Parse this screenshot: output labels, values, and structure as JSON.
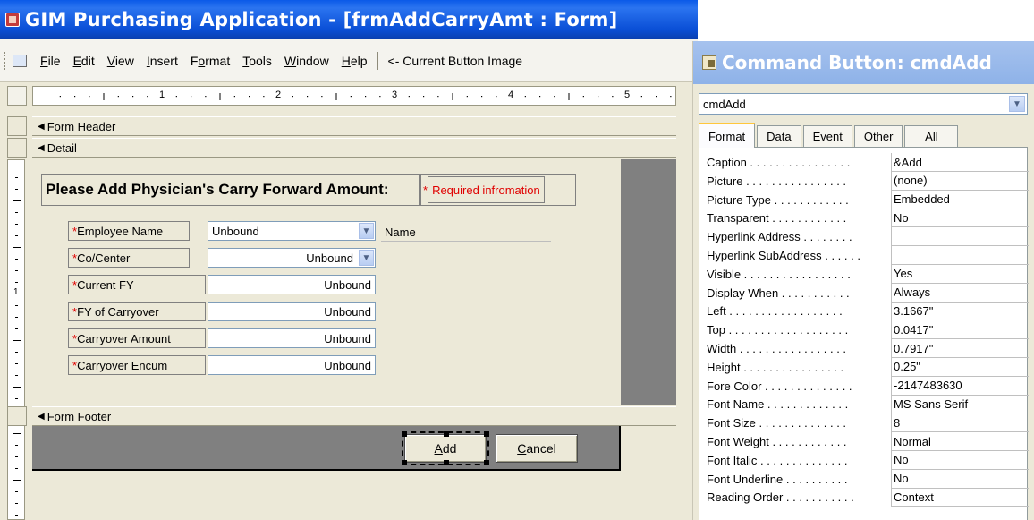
{
  "main_window": {
    "title": "GIM Purchasing Application - [frmAddCarryAmt : Form]"
  },
  "menu": {
    "items": [
      {
        "pre": "",
        "ul": "F",
        "post": "ile"
      },
      {
        "pre": "",
        "ul": "E",
        "post": "dit"
      },
      {
        "pre": "",
        "ul": "V",
        "post": "iew"
      },
      {
        "pre": "",
        "ul": "I",
        "post": "nsert"
      },
      {
        "pre": "F",
        "ul": "o",
        "post": "rmat"
      },
      {
        "pre": "",
        "ul": "T",
        "post": "ools"
      },
      {
        "pre": "",
        "ul": "W",
        "post": "indow"
      },
      {
        "pre": "",
        "ul": "H",
        "post": "elp"
      }
    ],
    "current_button_image": "<- Current Button Image"
  },
  "ruler": {
    "numbers": [
      "1",
      "2",
      "3",
      "4",
      "5"
    ],
    "vertical_numbers": [
      "1"
    ]
  },
  "sections": {
    "form_header": "Form Header",
    "detail": "Detail",
    "form_footer": "Form Footer"
  },
  "form": {
    "heading": "Please Add Physician's Carry Forward Amount:",
    "required_asterisk": "*",
    "required_text": "Required infromation",
    "fields": [
      {
        "label": "Employee Name",
        "value": "Unbound",
        "type": "combo-left"
      },
      {
        "label": "Co/Center",
        "value": "Unbound",
        "type": "combo-right"
      },
      {
        "label": "Current FY",
        "value": "Unbound",
        "type": "text"
      },
      {
        "label": "FY of Carryover",
        "value": "Unbound",
        "type": "text"
      },
      {
        "label": "Carryover Amount",
        "value": "Unbound",
        "type": "text"
      },
      {
        "label": "Carryover Encum",
        "value": "Unbound",
        "type": "text"
      }
    ],
    "name_label": "Name"
  },
  "footer": {
    "add": {
      "ul": "A",
      "post": "dd"
    },
    "cancel": {
      "ul": "C",
      "post": "ancel"
    }
  },
  "property_sheet": {
    "title": "Command Button: cmdAdd",
    "selected_object": "cmdAdd",
    "tabs": [
      "Format",
      "Data",
      "Event",
      "Other",
      "All"
    ],
    "active_tab": "Format",
    "properties": [
      {
        "name": "Caption . . . . . . . . . . . . . . . .",
        "value": "&Add"
      },
      {
        "name": "Picture . . . . . . . . . . . . . . . .",
        "value": "(none)"
      },
      {
        "name": "Picture Type . . . . . . . . . . . .",
        "value": "Embedded"
      },
      {
        "name": "Transparent . . . . . . . . . . . .",
        "value": "No"
      },
      {
        "name": "Hyperlink Address . . . . . . . .",
        "value": ""
      },
      {
        "name": "Hyperlink SubAddress . . . . . .",
        "value": ""
      },
      {
        "name": "Visible . . . . . . . . . . . . . . . . .",
        "value": "Yes"
      },
      {
        "name": "Display When . . . . . . . . . . .",
        "value": "Always"
      },
      {
        "name": "Left . . . . . . . . . . . . . . . . . .",
        "value": "3.1667\""
      },
      {
        "name": "Top . . . . . . . . . . . . . . . . . . .",
        "value": "0.0417\""
      },
      {
        "name": "Width . . . . . . . . . . . . . . . . .",
        "value": "0.7917\""
      },
      {
        "name": "Height . . . . . . . . . . . . . . . .",
        "value": "0.25\""
      },
      {
        "name": "Fore Color . . . . . . . . . . . . . .",
        "value": "-2147483630"
      },
      {
        "name": "Font Name . . . . . . . . . . . . .",
        "value": "MS Sans Serif"
      },
      {
        "name": "Font Size . . . . . . . . . . . . . .",
        "value": "8"
      },
      {
        "name": "Font Weight . . . . . . . . . . . .",
        "value": "Normal"
      },
      {
        "name": "Font Italic . . . . . . . . . . . . . .",
        "value": "No"
      },
      {
        "name": "Font Underline . . . . . . . . . .",
        "value": "No"
      },
      {
        "name": "Reading Order . . . . . . . . . . .",
        "value": "Context"
      }
    ]
  },
  "colors": {
    "title_bar": "#0a4fd6",
    "required_red": "#e00000",
    "detail_grid": "#ece9d8",
    "detail_background": "#808080",
    "active_tab_accent": "#ffc73c"
  }
}
